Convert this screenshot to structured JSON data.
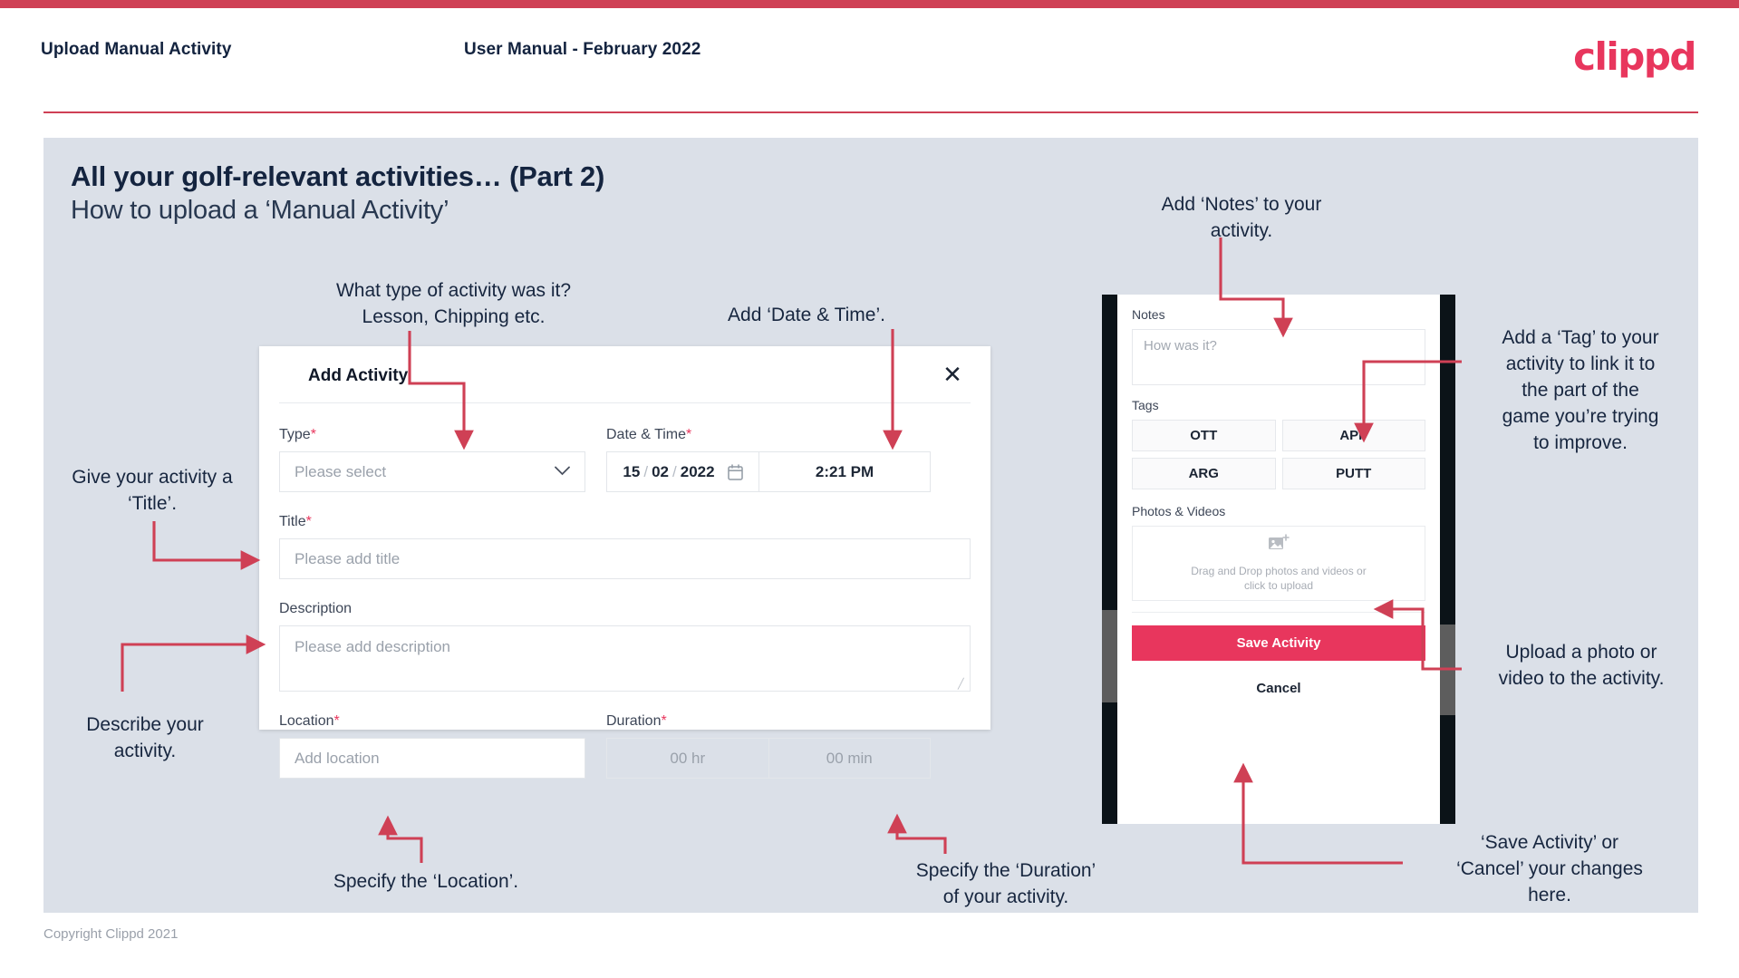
{
  "header": {
    "title": "Upload Manual Activity",
    "subtitle": "User Manual - February 2022",
    "logo": "clippd"
  },
  "slide": {
    "title": "All your golf-relevant activities… (Part 2)",
    "subtitle": "How to upload a ‘Manual Activity’"
  },
  "footer": {
    "copyright": "Copyright Clippd 2021"
  },
  "dialog": {
    "title": "Add Activity",
    "close_icon": "close-icon",
    "fields": {
      "type": {
        "label": "Type",
        "required": "*",
        "placeholder": "Please select",
        "chevron": "chevron-down-icon"
      },
      "datetime": {
        "label": "Date & Time",
        "required": "*",
        "day": "15",
        "month": "02",
        "year": "2022",
        "sep": "/",
        "calendar_icon": "calendar-icon",
        "time": "2:21 PM"
      },
      "title": {
        "label": "Title",
        "required": "*",
        "placeholder": "Please add title"
      },
      "description": {
        "label": "Description",
        "placeholder": "Please add description"
      },
      "location": {
        "label": "Location",
        "required": "*",
        "placeholder": "Add location"
      },
      "duration": {
        "label": "Duration",
        "required": "*",
        "hours": "00 hr",
        "minutes": "00 min"
      }
    }
  },
  "phone": {
    "notes": {
      "label": "Notes",
      "placeholder": "How was it?"
    },
    "tags": {
      "label": "Tags",
      "items": [
        "OTT",
        "APP",
        "ARG",
        "PUTT"
      ]
    },
    "photos": {
      "label": "Photos & Videos",
      "icon": "add-image-icon",
      "dropzone_line1": "Drag and Drop photos and videos or",
      "dropzone_line2": "click to upload"
    },
    "save_button": "Save Activity",
    "cancel_button": "Cancel"
  },
  "annotations": {
    "type": "What type of activity was it?\nLesson, Chipping etc.",
    "datetime": "Add ‘Date & Time’.",
    "title": "Give your activity a\n‘Title’.",
    "description": "Describe your\nactivity.",
    "location": "Specify the ‘Location’.",
    "duration": "Specify the ‘Duration’\nof your activity.",
    "notes": "Add ‘Notes’ to your\nactivity.",
    "tags": "Add a ‘Tag’ to your\nactivity to link it to\nthe part of the\ngame you’re trying\nto improve.",
    "upload": "Upload a photo or\nvideo to the activity.",
    "save": "‘Save Activity’ or\n‘Cancel’ your changes\nhere."
  },
  "colors": {
    "brand": "#e8365d",
    "topbar": "#cf4055",
    "slide_bg": "#dbe0e8",
    "arrow": "#cf4055",
    "text_dark": "#14243f"
  }
}
